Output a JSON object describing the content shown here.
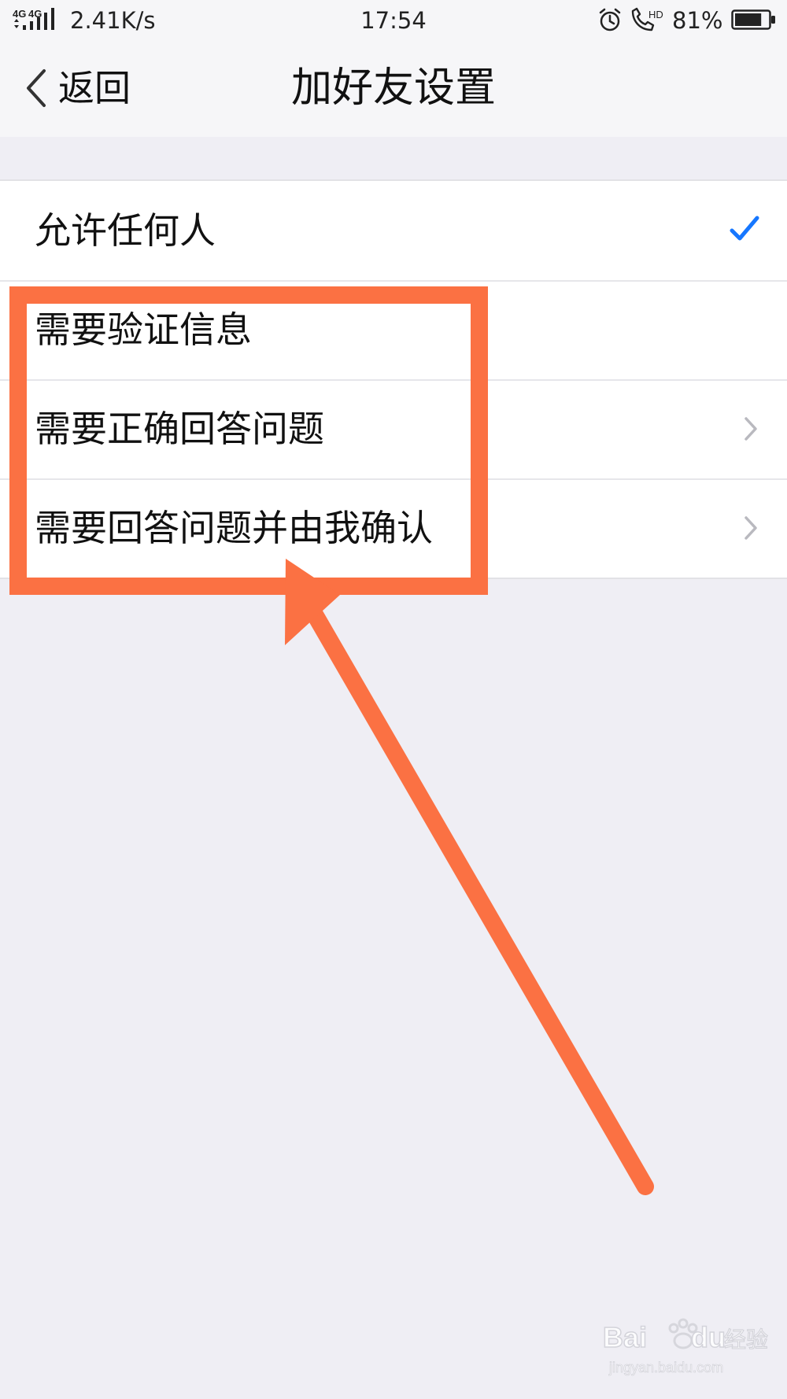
{
  "status_bar": {
    "network": "4G 4G",
    "speed": "2.41K/s",
    "time": "17:54",
    "alarm_icon": "alarm-clock-icon",
    "call_icon": "hd-call-icon",
    "call_badge": "HD",
    "battery_percent": "81%",
    "battery_level": 0.81
  },
  "nav": {
    "back_label": "返回",
    "title": "加好友设置"
  },
  "options": [
    {
      "label": "允许任何人",
      "selected": true,
      "accessory": "checkmark"
    },
    {
      "label": "需要验证信息",
      "selected": false,
      "accessory": "none"
    },
    {
      "label": "需要正确回答问题",
      "selected": false,
      "accessory": "chevron"
    },
    {
      "label": "需要回答问题并由我确认",
      "selected": false,
      "accessory": "chevron"
    }
  ],
  "colors": {
    "accent_check": "#1677ff",
    "annotation": "#fb7143",
    "chevron": "#b9b9bf",
    "background": "#efeef4"
  },
  "watermark": {
    "brand": "Baidu",
    "label": "经验",
    "url": "jingyan.baidu.com"
  }
}
